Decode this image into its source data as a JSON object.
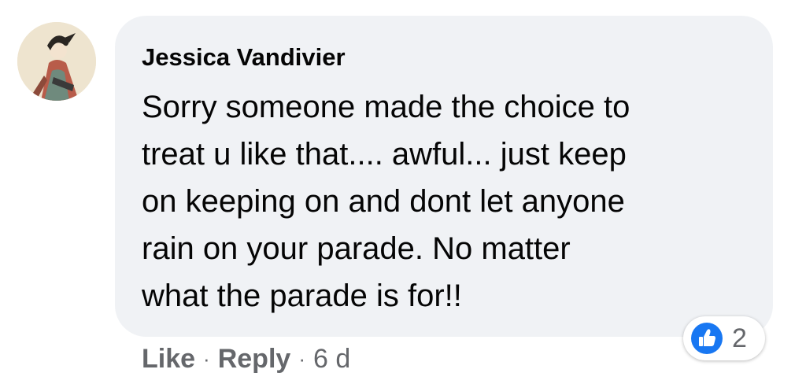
{
  "comment": {
    "author": "Jessica Vandivier",
    "text_lines": [
      "Sorry someone made the choice to",
      "treat u like that.... awful... just keep",
      "on keeping on and dont let anyone",
      "rain on your parade. No matter",
      "what the parade is for!!"
    ],
    "reaction_icon": "like-thumbs-up-icon",
    "reaction_count": "2"
  },
  "actions": {
    "like_label": "Like",
    "separator": "·",
    "reply_label": "Reply",
    "timestamp": "6 d"
  },
  "colors": {
    "bubble_background": "#f0f2f5",
    "secondary_text": "#65676b",
    "like_blue": "#1877f2"
  }
}
